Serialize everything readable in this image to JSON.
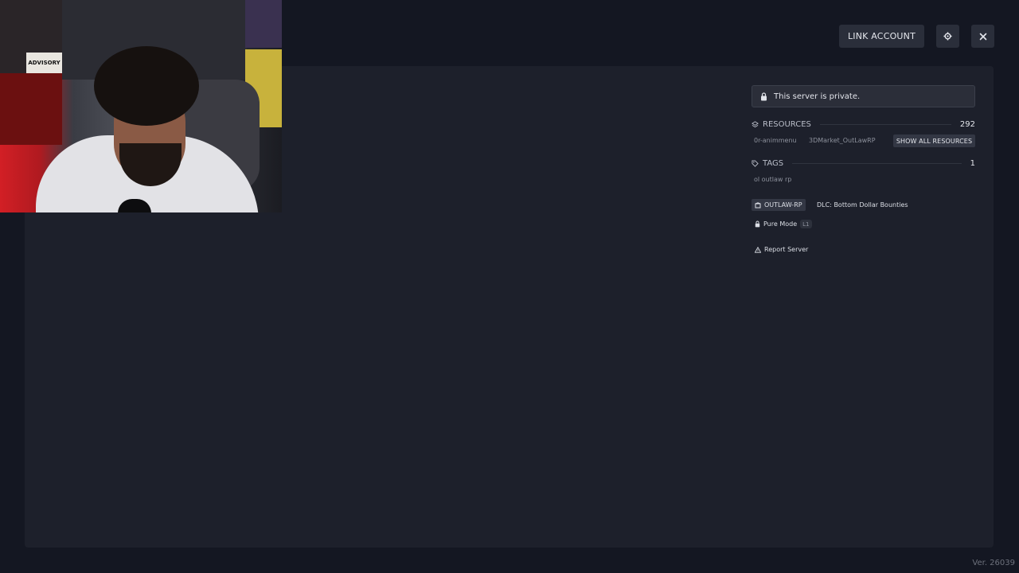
{
  "header": {
    "link_account_label": "LINK ACCOUNT",
    "settings_icon": "gear-icon",
    "close_icon": "close-icon"
  },
  "server": {
    "private_notice": "This server is private.",
    "resources": {
      "title": "RESOURCES",
      "count": "292",
      "items": [
        "0r-animmenu",
        "3DMarket_OutLawRP"
      ],
      "show_all_label": "SHOW ALL RESOURCES"
    },
    "tags": {
      "title": "TAGS",
      "count": "1",
      "items": [
        "ol outlaw rp"
      ]
    },
    "badges": {
      "gamename": "OUTLAW-RP",
      "dlc": "DLC: Bottom Dollar Bounties",
      "pure_mode": "Pure Mode",
      "pure_level": "L1"
    },
    "report_label": "Report Server"
  },
  "webcam": {
    "poster_text": "ADVISORY"
  },
  "footer": {
    "version": "Ver. 26039"
  },
  "colors": {
    "background": "#141722",
    "panel": "#1d202b",
    "button": "#2a2e3a"
  }
}
